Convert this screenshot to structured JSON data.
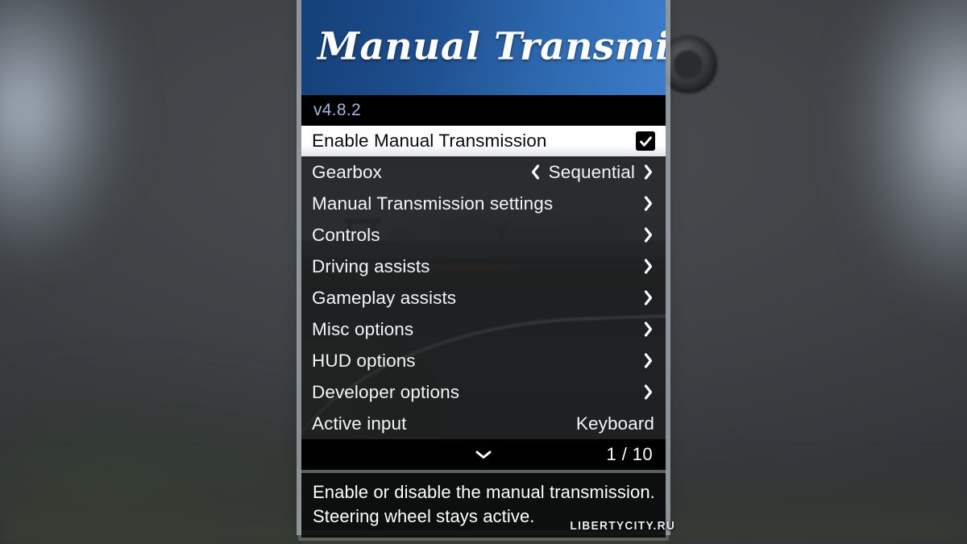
{
  "header": {
    "title": "Manual Transmission",
    "version": "v4.8.2"
  },
  "selected_row": {
    "label": "Enable Manual Transmission",
    "checkbox_icon": "checkmark-icon",
    "checked": true
  },
  "menu": {
    "rows": [
      {
        "label": "Gearbox",
        "value": "Sequential",
        "control": "left-right-selector"
      },
      {
        "label": "Manual Transmission settings",
        "value": "",
        "control": "submenu-chevron"
      },
      {
        "label": "Controls",
        "value": "",
        "control": "submenu-chevron"
      },
      {
        "label": "Driving assists",
        "value": "",
        "control": "submenu-chevron"
      },
      {
        "label": "Gameplay assists",
        "value": "",
        "control": "submenu-chevron"
      },
      {
        "label": "Misc options",
        "value": "",
        "control": "submenu-chevron"
      },
      {
        "label": "HUD options",
        "value": "",
        "control": "submenu-chevron"
      },
      {
        "label": "Developer options",
        "value": "",
        "control": "submenu-chevron"
      },
      {
        "label": "Active input",
        "value": "Keyboard",
        "control": "none"
      }
    ]
  },
  "footer": {
    "scroll_icon": "chevron-down-icon",
    "page_counter": "1 / 10"
  },
  "description": {
    "line1": "Enable or disable the manual transmission.",
    "line2": "Steering wheel stays active."
  },
  "watermark": {
    "text": "LibertyCity.Ru"
  },
  "colors": {
    "banner_dark": "#154078",
    "banner_light": "#3d7cc9",
    "version_text": "#9bb9d9",
    "selected_bg": "#ffffff",
    "menu_text": "#f3f4f5",
    "footer_bg": "#000000"
  }
}
